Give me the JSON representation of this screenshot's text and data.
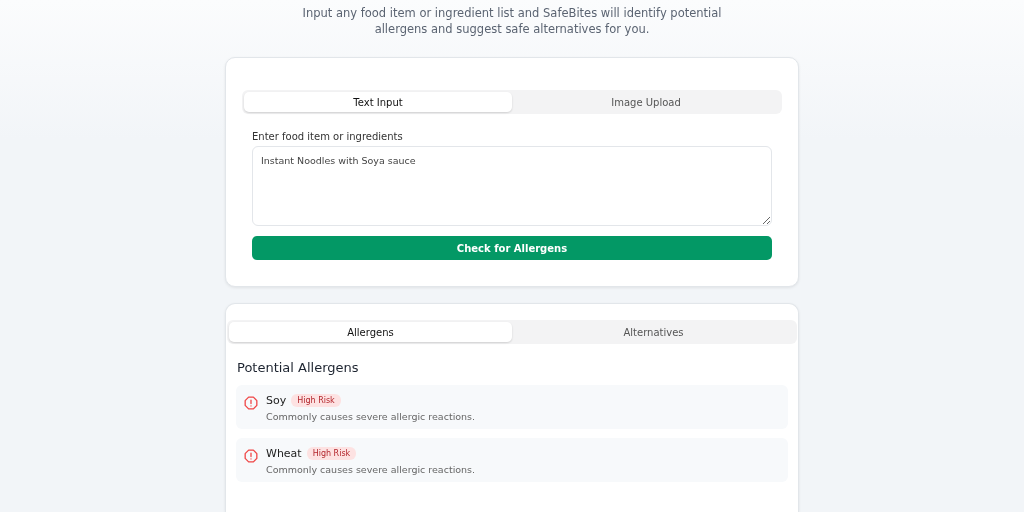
{
  "intro": "Input any food item or ingredient list and SafeBites will identify potential allergens and suggest safe alternatives for you.",
  "input_tabs": [
    {
      "label": "Text Input",
      "selected": true
    },
    {
      "label": "Image Upload",
      "selected": false
    }
  ],
  "field": {
    "label": "Enter food item or ingredients",
    "value": "Instant Noodles with Soya sauce"
  },
  "check_button": "Check for Allergens",
  "result_tabs": [
    {
      "label": "Allergens",
      "selected": true
    },
    {
      "label": "Alternatives",
      "selected": false
    }
  ],
  "results_heading": "Potential Allergens",
  "allergens": [
    {
      "name": "Soy",
      "risk": "High Risk",
      "description": "Commonly causes severe allergic reactions."
    },
    {
      "name": "Wheat",
      "risk": "High Risk",
      "description": "Commonly causes severe allergic reactions."
    }
  ]
}
